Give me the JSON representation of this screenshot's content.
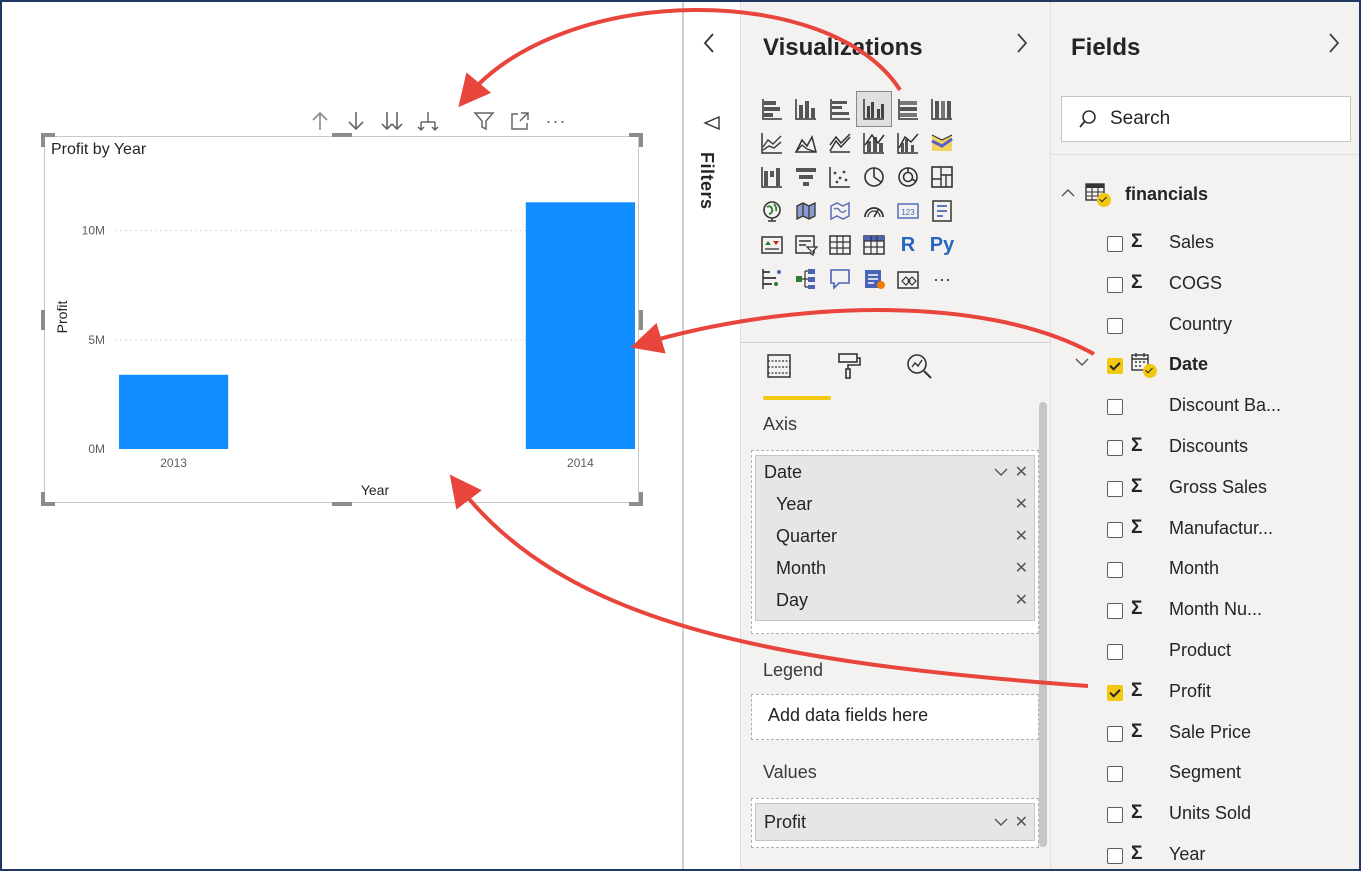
{
  "visual": {
    "toolbar": {
      "more_label": "···"
    },
    "title": "Profit by Year"
  },
  "filters": {
    "label": "Filters"
  },
  "visualizations": {
    "title": "Visualizations",
    "more_label": "···",
    "r_label": "R",
    "py_label": "Py",
    "wells": {
      "axis": {
        "title": "Axis",
        "field": "Date",
        "hierarchy": [
          "Year",
          "Quarter",
          "Month",
          "Day"
        ]
      },
      "legend": {
        "title": "Legend",
        "placeholder": "Add data fields here"
      },
      "values": {
        "title": "Values",
        "field": "Profit"
      }
    }
  },
  "fields": {
    "title": "Fields",
    "search_placeholder": "Search",
    "table_name": "financials",
    "items": [
      {
        "label": "Sales",
        "checked": false,
        "sigma": true
      },
      {
        "label": "COGS",
        "checked": false,
        "sigma": true
      },
      {
        "label": "Country",
        "checked": false,
        "sigma": false
      },
      {
        "label": "Date",
        "checked": true,
        "sigma": false,
        "hierarchy": true
      },
      {
        "label": "Discount Ba...",
        "checked": false,
        "sigma": false
      },
      {
        "label": "Discounts",
        "checked": false,
        "sigma": true
      },
      {
        "label": "Gross Sales",
        "checked": false,
        "sigma": true
      },
      {
        "label": "Manufactur...",
        "checked": false,
        "sigma": true
      },
      {
        "label": "Month",
        "checked": false,
        "sigma": false
      },
      {
        "label": "Month Nu...",
        "checked": false,
        "sigma": true
      },
      {
        "label": "Product",
        "checked": false,
        "sigma": false
      },
      {
        "label": "Profit",
        "checked": true,
        "sigma": true
      },
      {
        "label": "Sale Price",
        "checked": false,
        "sigma": true
      },
      {
        "label": "Segment",
        "checked": false,
        "sigma": false
      },
      {
        "label": "Units Sold",
        "checked": false,
        "sigma": true
      },
      {
        "label": "Year",
        "checked": false,
        "sigma": true
      }
    ]
  },
  "colors": {
    "bar": "#118dff",
    "accent": "#f2c811",
    "arrow": "#e8453c"
  },
  "chart_data": {
    "type": "bar",
    "title": "Profit by Year",
    "xlabel": "Year",
    "ylabel": "Profit",
    "categories": [
      "2013",
      "2014"
    ],
    "values": [
      3400000,
      11300000
    ],
    "ylim": [
      0,
      12000000
    ],
    "yticks": [
      {
        "value": 0,
        "label": "0M"
      },
      {
        "value": 5000000,
        "label": "5M"
      },
      {
        "value": 10000000,
        "label": "10M"
      }
    ],
    "grid": true
  }
}
